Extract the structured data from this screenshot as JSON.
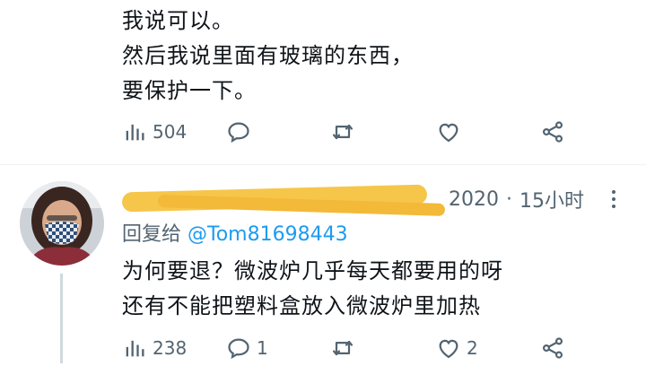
{
  "top_tweet": {
    "lines": [
      "我说可以。",
      "然后我说里面有玻璃的东西，",
      "要保护一下。"
    ],
    "actions": {
      "views": "504",
      "replies": "",
      "retweets": "",
      "likes": ""
    }
  },
  "reply_tweet": {
    "date_partial": "2020",
    "separator": "·",
    "time_ago": "15小时",
    "reply_to_label": "回复给",
    "reply_to_handle": "@Tom81698443",
    "lines": [
      "为何要退？微波炉几乎每天都要用的呀",
      "还有不能把塑料盒放入微波炉里加热"
    ],
    "actions": {
      "views": "238",
      "replies": "1",
      "retweets": "",
      "likes": "2"
    }
  },
  "colors": {
    "text": "#0f1419",
    "muted": "#536471",
    "link": "#1d9bf0",
    "redaction": "#f6c64a"
  },
  "icons": [
    "views-icon",
    "reply-icon",
    "retweet-icon",
    "like-icon",
    "share-icon",
    "more-icon"
  ]
}
